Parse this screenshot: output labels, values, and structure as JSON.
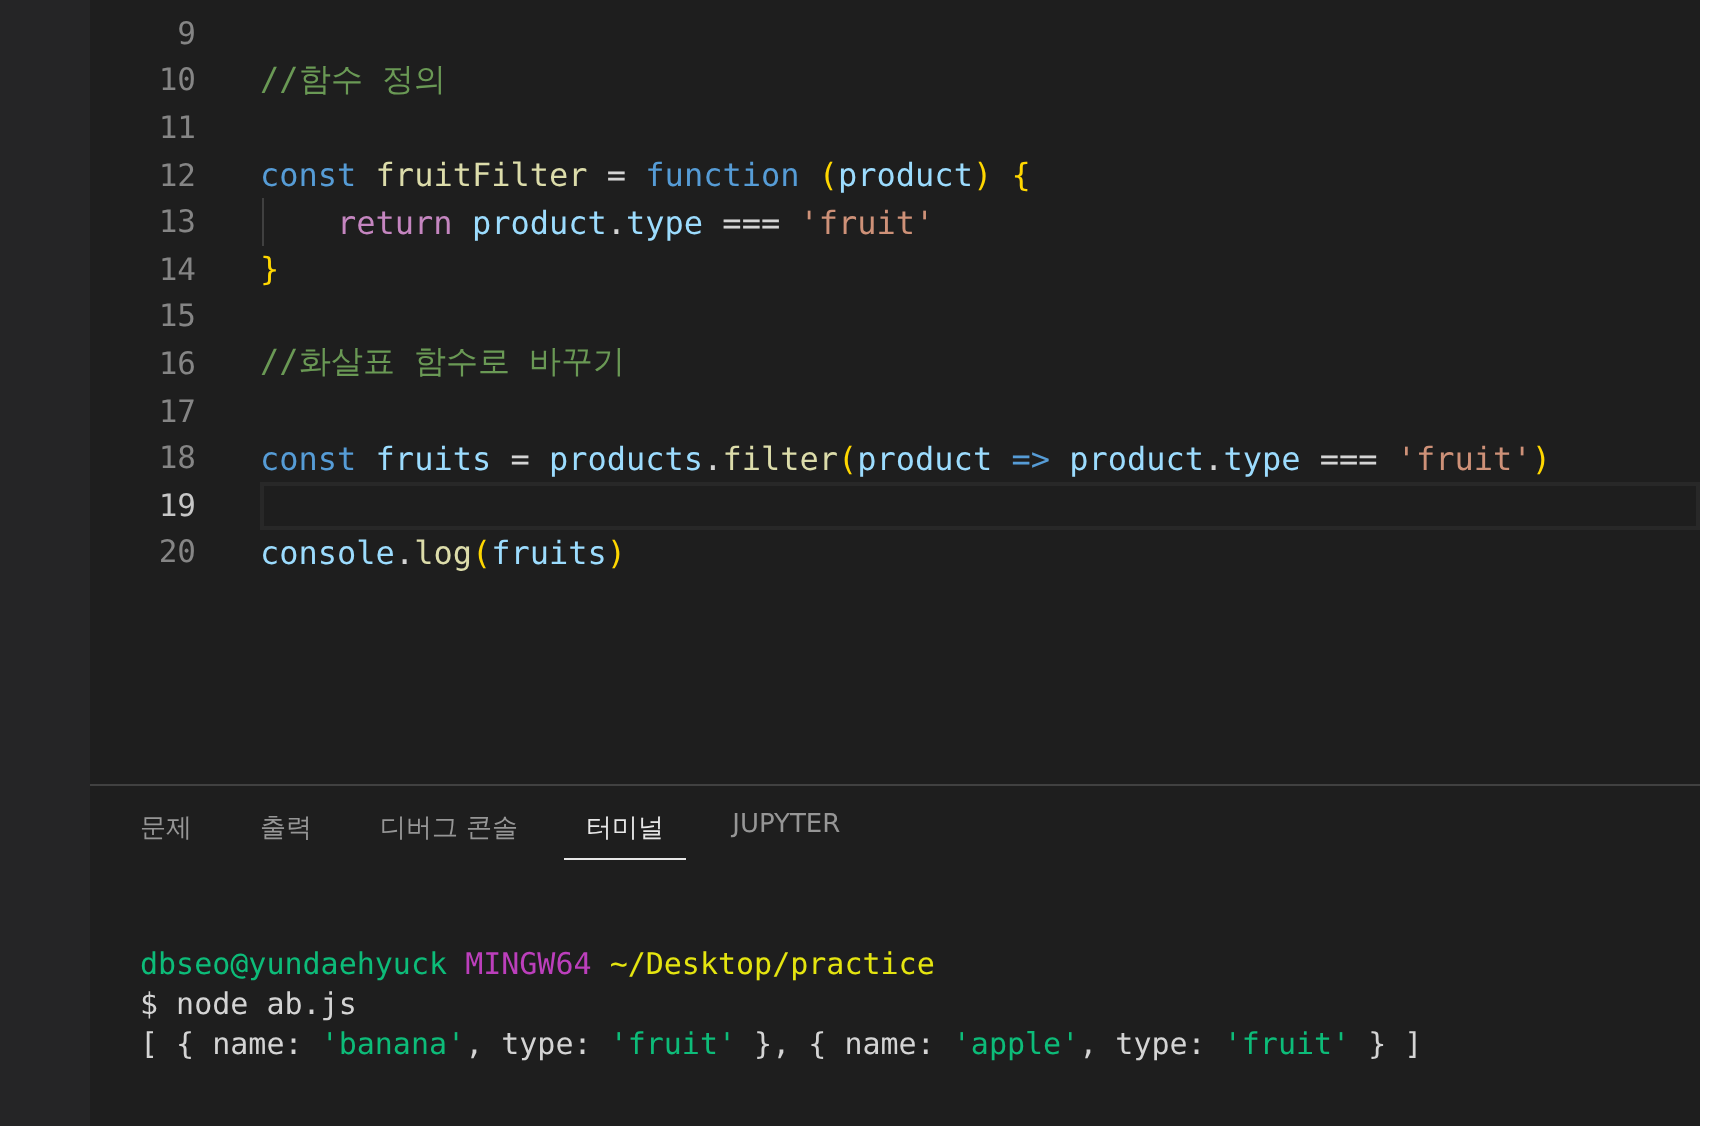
{
  "editor": {
    "lines": [
      {
        "number": "9"
      },
      {
        "number": "10",
        "tokens": [
          {
            "kind": "comment",
            "text": "//함수 정의"
          }
        ]
      },
      {
        "number": "11"
      },
      {
        "number": "12",
        "tokens": [
          {
            "kind": "keyword",
            "text": "const "
          },
          {
            "kind": "function",
            "text": "fruitFilter"
          },
          {
            "kind": "plain",
            "text": " = "
          },
          {
            "kind": "keyword",
            "text": "function "
          },
          {
            "kind": "bracket",
            "text": "("
          },
          {
            "kind": "variable",
            "text": "product"
          },
          {
            "kind": "bracket",
            "text": ") {"
          }
        ]
      },
      {
        "number": "13",
        "indent_guide": true,
        "tokens": [
          {
            "kind": "control",
            "text": "return "
          },
          {
            "kind": "variable",
            "text": "product"
          },
          {
            "kind": "plain",
            "text": "."
          },
          {
            "kind": "variable",
            "text": "type"
          },
          {
            "kind": "plain",
            "text": " === "
          },
          {
            "kind": "string",
            "text": "'fruit'"
          }
        ]
      },
      {
        "number": "14",
        "tokens": [
          {
            "kind": "bracket",
            "text": "}"
          }
        ]
      },
      {
        "number": "15"
      },
      {
        "number": "16",
        "tokens": [
          {
            "kind": "comment",
            "text": "//화살표 함수로 바꾸기"
          }
        ]
      },
      {
        "number": "17"
      },
      {
        "number": "18",
        "tokens": [
          {
            "kind": "keyword",
            "text": "const "
          },
          {
            "kind": "variable",
            "text": "fruits"
          },
          {
            "kind": "plain",
            "text": " = "
          },
          {
            "kind": "variable",
            "text": "products"
          },
          {
            "kind": "plain",
            "text": "."
          },
          {
            "kind": "function",
            "text": "filter"
          },
          {
            "kind": "bracket",
            "text": "("
          },
          {
            "kind": "variable",
            "text": "product "
          },
          {
            "kind": "keyword",
            "text": "=> "
          },
          {
            "kind": "variable",
            "text": "product"
          },
          {
            "kind": "plain",
            "text": "."
          },
          {
            "kind": "variable",
            "text": "type"
          },
          {
            "kind": "plain",
            "text": " === "
          },
          {
            "kind": "string",
            "text": "'fruit'"
          },
          {
            "kind": "bracket",
            "text": ")"
          }
        ]
      },
      {
        "number": "19",
        "current": true
      },
      {
        "number": "20",
        "tokens": [
          {
            "kind": "variable",
            "text": "console"
          },
          {
            "kind": "plain",
            "text": "."
          },
          {
            "kind": "function",
            "text": "log"
          },
          {
            "kind": "bracket",
            "text": "("
          },
          {
            "kind": "variable",
            "text": "fruits"
          },
          {
            "kind": "bracket",
            "text": ")"
          }
        ]
      }
    ]
  },
  "panel": {
    "tabs": [
      {
        "label": "문제",
        "selected": false
      },
      {
        "label": "출력",
        "selected": false
      },
      {
        "label": "디버그 콘솔",
        "selected": false
      },
      {
        "label": "터미널",
        "selected": true
      },
      {
        "label": "JUPYTER",
        "selected": false
      }
    ],
    "terminal_lines": [
      {
        "tokens": [
          {
            "kind": "user",
            "text": "dbseo@yundaehyuck "
          },
          {
            "kind": "system",
            "text": "MINGW64 "
          },
          {
            "kind": "path",
            "text": "~/Desktop/practice"
          }
        ]
      },
      {
        "tokens": [
          {
            "kind": "plain",
            "text": "$ node ab.js"
          }
        ]
      },
      {
        "tokens": [
          {
            "kind": "plain",
            "text": "[ { name: "
          },
          {
            "kind": "tstring",
            "text": "'banana'"
          },
          {
            "kind": "plain",
            "text": ", type: "
          },
          {
            "kind": "tstring",
            "text": "'fruit'"
          },
          {
            "kind": "plain",
            "text": " }, { name: "
          },
          {
            "kind": "tstring",
            "text": "'apple'"
          },
          {
            "kind": "plain",
            "text": ", type: "
          },
          {
            "kind": "tstring",
            "text": "'fruit'"
          },
          {
            "kind": "plain",
            "text": " } ]"
          }
        ]
      }
    ]
  }
}
